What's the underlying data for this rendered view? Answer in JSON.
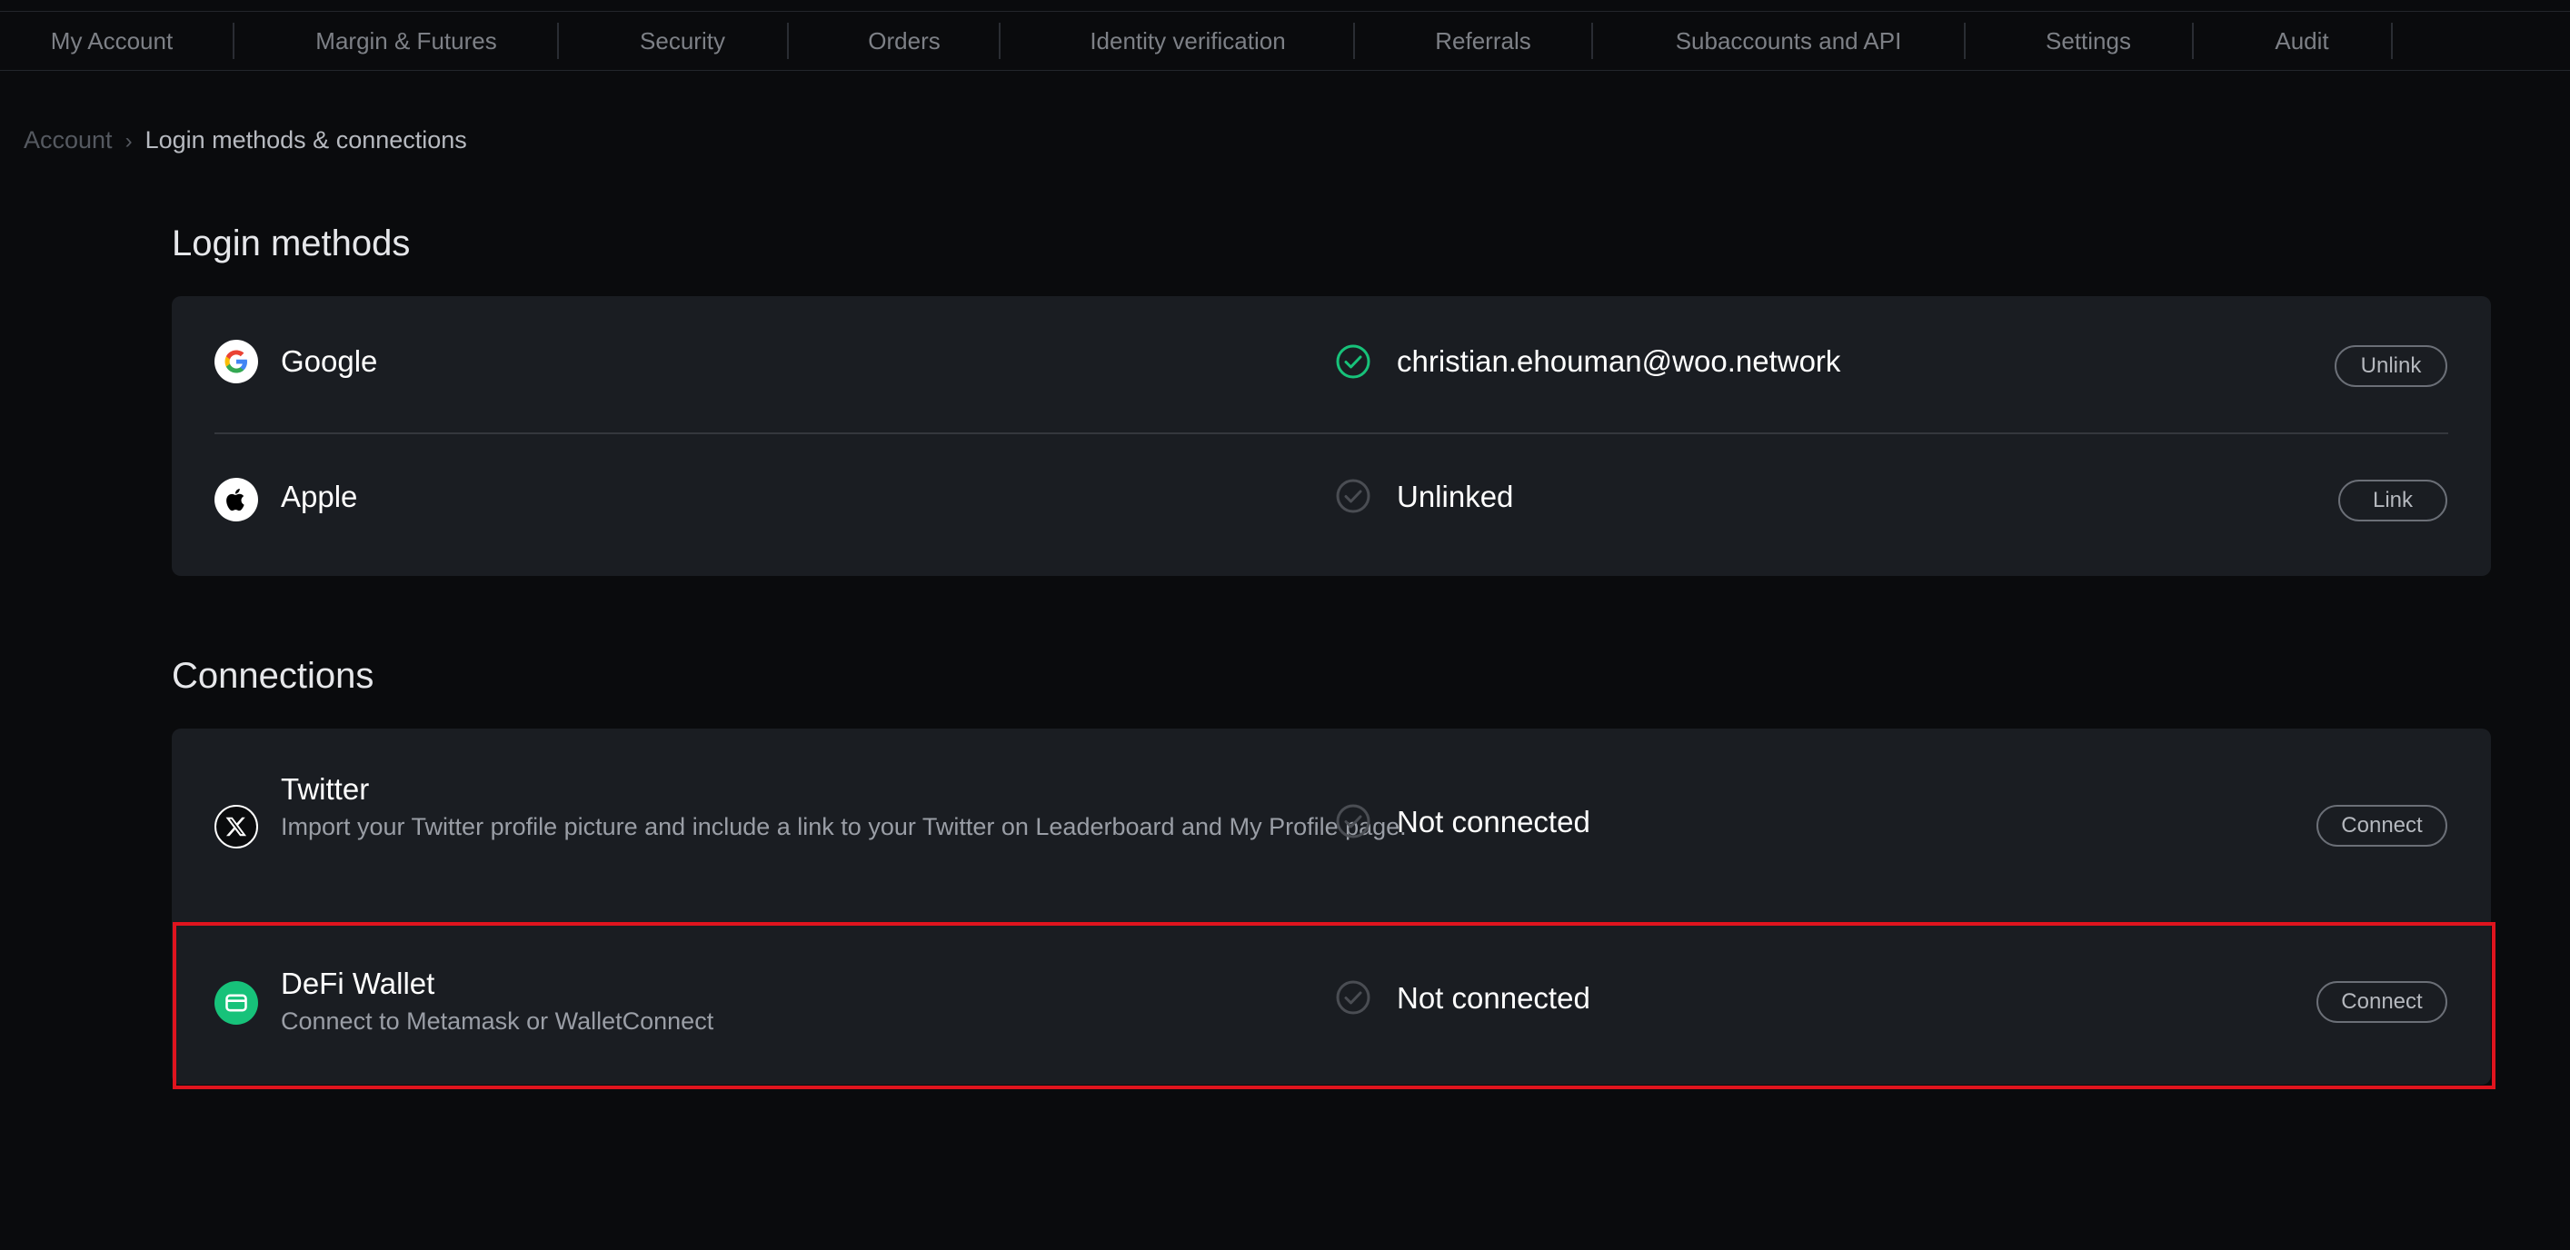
{
  "nav": {
    "tabs": [
      {
        "label": "My Account"
      },
      {
        "label": "Margin & Futures"
      },
      {
        "label": "Security"
      },
      {
        "label": "Orders"
      },
      {
        "label": "Identity verification"
      },
      {
        "label": "Referrals"
      },
      {
        "label": "Subaccounts and API"
      },
      {
        "label": "Settings"
      },
      {
        "label": "Audit"
      }
    ]
  },
  "breadcrumb": {
    "root": "Account",
    "separator": "›",
    "current": "Login methods & connections"
  },
  "login_methods": {
    "title": "Login methods",
    "items": [
      {
        "name": "Google",
        "icon": "google-icon",
        "status_icon": "check-circle-icon",
        "status_color": "#17c27a",
        "status": "christian.ehouman@woo.network",
        "action": "Unlink"
      },
      {
        "name": "Apple",
        "icon": "apple-icon",
        "status_icon": "check-circle-icon",
        "status_color": "#4a4d53",
        "status": "Unlinked",
        "action": "Link"
      }
    ]
  },
  "connections": {
    "title": "Connections",
    "items": [
      {
        "name": "Twitter",
        "icon": "x-twitter-icon",
        "description": "Import your Twitter profile picture and include a link to your Twitter on Leaderboard and My Profile page.",
        "status_icon": "check-circle-icon",
        "status_color": "#4a4d53",
        "status": "Not connected",
        "action": "Connect"
      },
      {
        "name": "DeFi Wallet",
        "icon": "wallet-icon",
        "description": "Connect to Metamask or WalletConnect",
        "status_icon": "check-circle-icon",
        "status_color": "#4a4d53",
        "status": "Not connected",
        "action": "Connect"
      }
    ]
  },
  "colors": {
    "background": "#0a0b0d",
    "card": "#1a1d22",
    "accent_green": "#17c27a",
    "highlight": "#e0141e"
  }
}
